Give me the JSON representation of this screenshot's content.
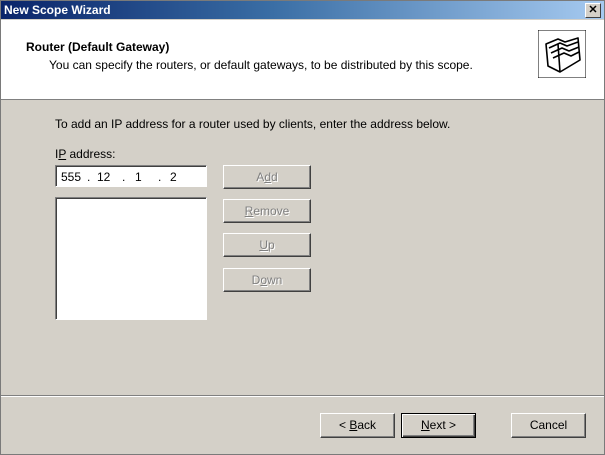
{
  "window": {
    "title": "New Scope Wizard",
    "close_glyph": "✕"
  },
  "header": {
    "title": "Router (Default Gateway)",
    "subtitle": "You can specify the routers, or default gateways, to be distributed by this scope.",
    "icon": "folder-icon"
  },
  "body": {
    "instruction": "To add an IP address for a router used by clients, enter the address below.",
    "ip_label_prefix": "I",
    "ip_label_accel": "P",
    "ip_label_suffix": " address:",
    "ip_address": {
      "octet1": "555",
      "octet2": "12",
      "octet3": "1",
      "octet4": "2"
    },
    "dot": "."
  },
  "buttons": {
    "add_prefix": "A",
    "add_accel": "d",
    "add_suffix": "d",
    "remove_accel": "R",
    "remove_suffix": "emove",
    "up_accel": "U",
    "up_suffix": "p",
    "down_prefix": "D",
    "down_accel": "o",
    "down_suffix": "wn"
  },
  "footer": {
    "back_prefix": "< ",
    "back_accel": "B",
    "back_suffix": "ack",
    "next_accel": "N",
    "next_suffix": "ext >",
    "cancel_label": "Cancel"
  }
}
